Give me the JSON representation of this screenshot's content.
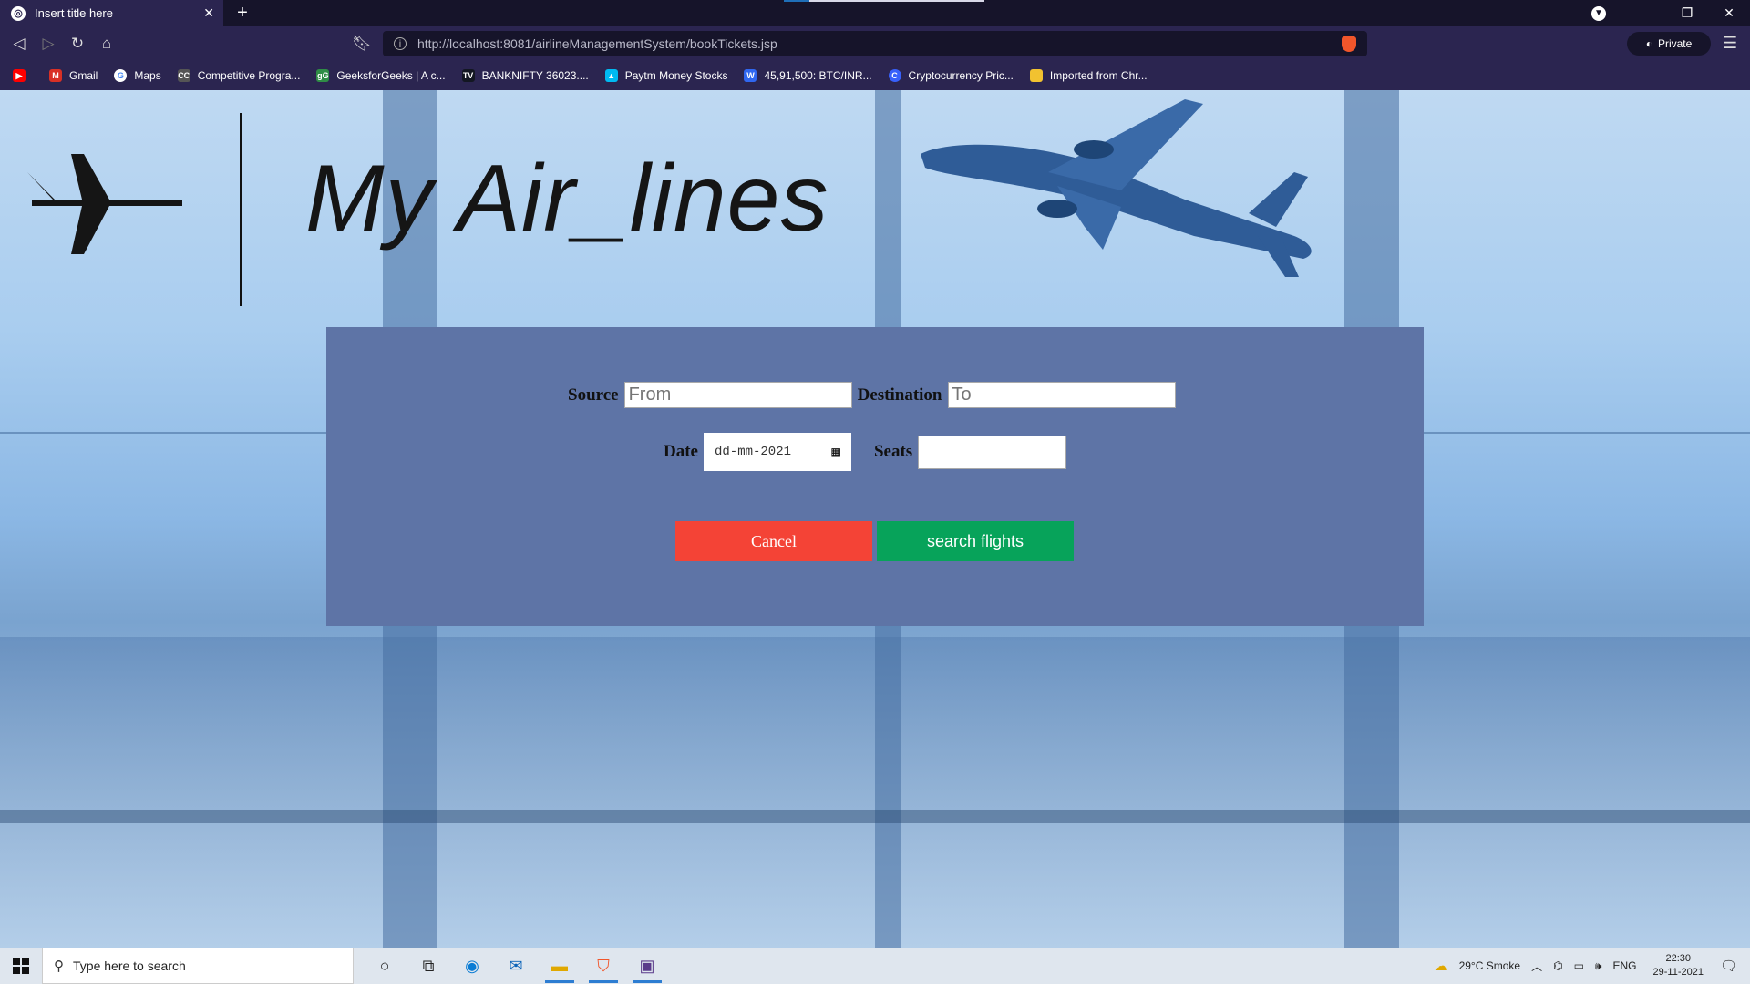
{
  "browser": {
    "tab_title": "Insert title here",
    "url": "http://localhost:8081/airlineManagementSystem/bookTickets.jsp",
    "private_label": "Private",
    "bookmarks": [
      {
        "label": "",
        "icon": "youtube-icon",
        "color": "#ff0000"
      },
      {
        "label": "Gmail",
        "icon": "gmail-icon",
        "color": "#d93025"
      },
      {
        "label": "Maps",
        "icon": "google-icon",
        "color": "#4285f4"
      },
      {
        "label": "Competitive Progra...",
        "icon": "cc-icon",
        "color": "#555555"
      },
      {
        "label": "GeeksforGeeks | A c...",
        "icon": "gfg-icon",
        "color": "#2f8d46"
      },
      {
        "label": "BANKNIFTY 36023....",
        "icon": "tradingview-icon",
        "color": "#131722"
      },
      {
        "label": "Paytm Money Stocks",
        "icon": "paytm-icon",
        "color": "#00baf2"
      },
      {
        "label": "45,91,500: BTC/INR...",
        "icon": "wazirx-icon",
        "color": "#3067f0"
      },
      {
        "label": "Cryptocurrency Pric...",
        "icon": "coinmarketcap-icon",
        "color": "#3861fb"
      },
      {
        "label": "Imported from Chr...",
        "icon": "folder-icon",
        "color": "#f2c230"
      }
    ]
  },
  "page": {
    "brand": "My Air_lines",
    "form": {
      "source_label": "Source",
      "source_placeholder": "From",
      "destination_label": "Destination",
      "destination_placeholder": "To",
      "date_label": "Date",
      "date_value": "dd-mm-2021",
      "seats_label": "Seats",
      "seats_value": "",
      "cancel_label": "Cancel",
      "search_label": "search flights"
    },
    "colors": {
      "panel": "#5e74a6",
      "cancel": "#f44336",
      "search": "#07a35a"
    }
  },
  "taskbar": {
    "search_placeholder": "Type here to search",
    "weather": "29°C  Smoke",
    "language": "ENG",
    "time": "22:30",
    "date": "29-11-2021"
  }
}
